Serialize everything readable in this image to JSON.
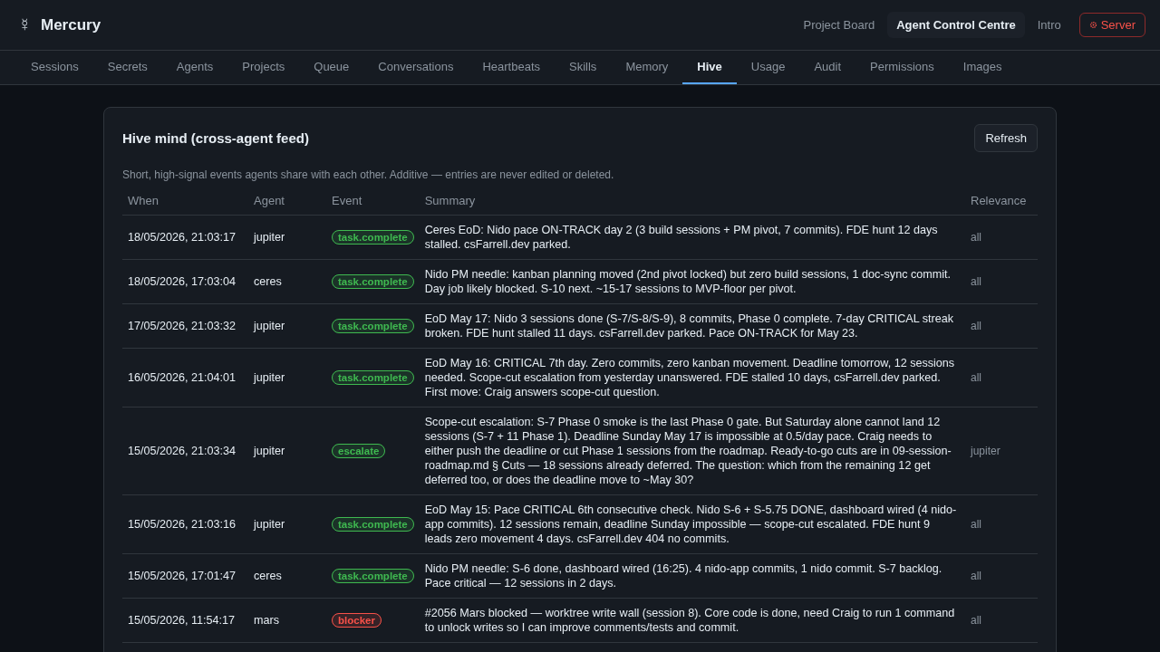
{
  "header": {
    "logo_symbol": "☿",
    "brand": "Mercury",
    "links": [
      {
        "label": "Project Board",
        "selected": false
      },
      {
        "label": "Agent Control Centre",
        "selected": true
      },
      {
        "label": "Intro",
        "selected": false
      }
    ],
    "server_button": "Server"
  },
  "tabs": [
    {
      "label": "Sessions",
      "selected": false
    },
    {
      "label": "Secrets",
      "selected": false
    },
    {
      "label": "Agents",
      "selected": false
    },
    {
      "label": "Projects",
      "selected": false
    },
    {
      "label": "Queue",
      "selected": false
    },
    {
      "label": "Conversations",
      "selected": false
    },
    {
      "label": "Heartbeats",
      "selected": false
    },
    {
      "label": "Skills",
      "selected": false
    },
    {
      "label": "Memory",
      "selected": false
    },
    {
      "label": "Hive",
      "selected": true
    },
    {
      "label": "Usage",
      "selected": false
    },
    {
      "label": "Audit",
      "selected": false
    },
    {
      "label": "Permissions",
      "selected": false
    },
    {
      "label": "Images",
      "selected": false
    }
  ],
  "panel": {
    "title": "Hive mind (cross-agent feed)",
    "refresh_button": "Refresh",
    "description": "Short, high-signal events agents share with each other. Additive — entries are never edited or deleted.",
    "table": {
      "columns": [
        "When",
        "Agent",
        "Event",
        "Summary",
        "Relevance"
      ],
      "rows": [
        {
          "when": "18/05/2026, 21:03:17",
          "agent": "jupiter",
          "event": {
            "label": "task.complete",
            "color": "#3fb950"
          },
          "summary": "Ceres EoD: Nido pace ON-TRACK day 2 (3 build sessions + PM pivot, 7 commits). FDE hunt 12 days stalled. csFarrell.dev parked.",
          "relevance": "all"
        },
        {
          "when": "18/05/2026, 17:03:04",
          "agent": "ceres",
          "event": {
            "label": "task.complete",
            "color": "#3fb950"
          },
          "summary": "Nido PM needle: kanban planning moved (2nd pivot locked) but zero build sessions, 1 doc-sync commit. Day job likely blocked. S-10 next. ~15-17 sessions to MVP-floor per pivot.",
          "relevance": "all"
        },
        {
          "when": "17/05/2026, 21:03:32",
          "agent": "jupiter",
          "event": {
            "label": "task.complete",
            "color": "#3fb950"
          },
          "summary": "EoD May 17: Nido 3 sessions done (S-7/S-8/S-9), 8 commits, Phase 0 complete. 7-day CRITICAL streak broken. FDE hunt stalled 11 days. csFarrell.dev parked. Pace ON-TRACK for May 23.",
          "relevance": "all"
        },
        {
          "when": "16/05/2026, 21:04:01",
          "agent": "jupiter",
          "event": {
            "label": "task.complete",
            "color": "#3fb950"
          },
          "summary": "EoD May 16: CRITICAL 7th day. Zero commits, zero kanban movement. Deadline tomorrow, 12 sessions needed. Scope-cut escalation from yesterday unanswered. FDE stalled 10 days, csFarrell.dev parked. First move: Craig answers scope-cut question.",
          "relevance": "all"
        },
        {
          "when": "15/05/2026, 21:03:34",
          "agent": "jupiter",
          "event": {
            "label": "escalate",
            "color": "#3fb950"
          },
          "summary": "Scope-cut escalation: S-7 Phase 0 smoke is the last Phase 0 gate. But Saturday alone cannot land 12 sessions (S-7 + 11 Phase 1). Deadline Sunday May 17 is impossible at 0.5/day pace. Craig needs to either push the deadline or cut Phase 1 sessions from the roadmap. Ready-to-go cuts are in 09-session-roadmap.md § Cuts — 18 sessions already deferred. The question: which from the remaining 12 get deferred too, or does the deadline move to ~May 30?",
          "relevance": "jupiter"
        },
        {
          "when": "15/05/2026, 21:03:16",
          "agent": "jupiter",
          "event": {
            "label": "task.complete",
            "color": "#3fb950"
          },
          "summary": "EoD May 15: Pace CRITICAL 6th consecutive check. Nido S-6 + S-5.75 DONE, dashboard wired (4 nido-app commits). 12 sessions remain, deadline Sunday impossible — scope-cut escalated. FDE hunt 9 leads zero movement 4 days. csFarrell.dev 404 no commits.",
          "relevance": "all"
        },
        {
          "when": "15/05/2026, 17:01:47",
          "agent": "ceres",
          "event": {
            "label": "task.complete",
            "color": "#3fb950"
          },
          "summary": "Nido PM needle: S-6 done, dashboard wired (16:25). 4 nido-app commits, 1 nido commit. S-7 backlog. Pace critical — 12 sessions in 2 days.",
          "relevance": "all"
        },
        {
          "when": "15/05/2026, 11:54:17",
          "agent": "mars",
          "event": {
            "label": "blocker",
            "color": "#f85149"
          },
          "summary": "#2056 Mars blocked — worktree write wall (session 8). Core code is done, need Craig to run 1 command to unlock writes so I can improve comments/tests and commit.",
          "relevance": "all"
        }
      ]
    }
  }
}
